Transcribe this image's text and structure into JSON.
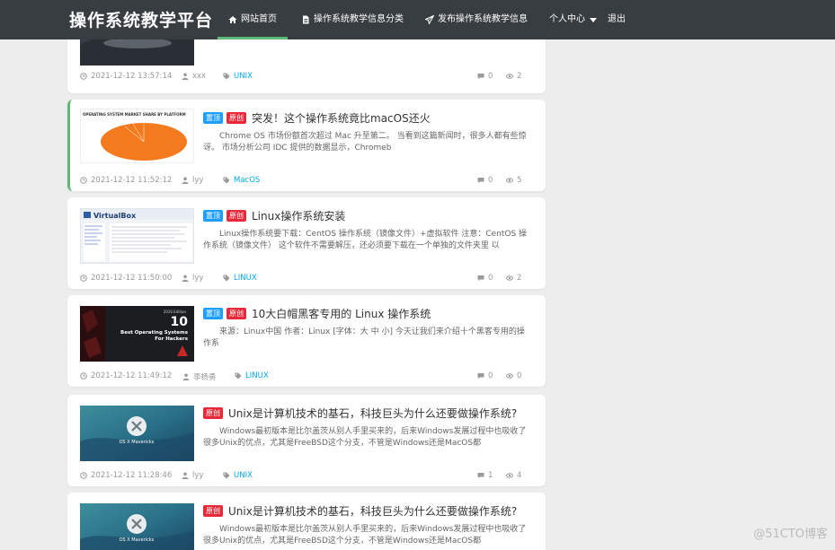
{
  "nav": {
    "brand": "操作系统教学平台",
    "home": "网站首页",
    "category": "操作系统教学信息分类",
    "publish": "发布操作系统教学信息",
    "user": "个人中心",
    "logout": "退出",
    "accent_color": "#5fb878"
  },
  "badges": {
    "top": "置顶",
    "original": "原创"
  },
  "articles": [
    {
      "title": "",
      "desc": "",
      "date": "2021-12-12 13:57:14",
      "author": "xxx",
      "tag": "UNIX",
      "comments": "0",
      "views": "2"
    },
    {
      "title": "突发！这个操作系统竟比macOS还火",
      "desc": "Chrome OS 市场份额首次超过 Mac 升至第二。 当看到这篇新闻时，很多人都有些惊讶。 市场分析公司 IDC 提供的数据显示，Chromeb",
      "date": "2021-12-12 11:52:12",
      "author": "lyy",
      "tag": "MacOS",
      "comments": "0",
      "views": "5",
      "thumb_title": "OPERATING SYSTEM MARKET SHARE BY PLATFORM"
    },
    {
      "title": "Linux操作系统安装",
      "desc": "Linux操作系统要下载：CentOS 操作系统（镜像文件）+虚拟软件 注意：CentOS 操作系统（镜像文件） 这个软件不需要解压，还必须要下载在一个单独的文件夹里 以",
      "date": "2021-12-12 11:50:00",
      "author": "lyy",
      "tag": "LINUX",
      "comments": "0",
      "views": "2",
      "thumb_title": "VirtualBox"
    },
    {
      "title": "10大白帽黑客专用的 Linux 操作系统",
      "desc": "来源：Linux中国 作者：Linux [字体：大 中 小] 今天让我们来介绍十个黑客专用的操作系",
      "date": "2021-12-12 11:49:12",
      "author": "李杨勇",
      "tag": "LINUX",
      "comments": "0",
      "views": "0",
      "thumb_num": "10",
      "thumb_line1": "Best Operating Systems",
      "thumb_line2": "For Hackers",
      "thumb_edition": "2016 Edition"
    },
    {
      "title": "Unix是计算机技术的基石，科技巨头为什么还要做操作系统?",
      "desc": "Windows最初版本是比尔盖茨从别人手里买来的，后来Windows发展过程中也吸收了很多Unix的优点，尤其是FreeBSD这个分支，不管是Windows还是MacOS都",
      "date": "2021-12-12 11:28:46",
      "author": "lyy",
      "tag": "UNIX",
      "comments": "1",
      "views": "4",
      "thumb_text": "OS X Mavericks"
    },
    {
      "title": "Unix是计算机技术的基石，科技巨头为什么还要做操作系统?",
      "desc": "Windows最初版本是比尔盖茨从别人手里买来的，后来Windows发展过程中也吸收了很多Unix的优点，尤其是FreeBSD这个分支，不管是Windows还是MacOS都",
      "thumb_text": "OS X Mavericks"
    }
  ],
  "watermark": "@51CTO博客"
}
